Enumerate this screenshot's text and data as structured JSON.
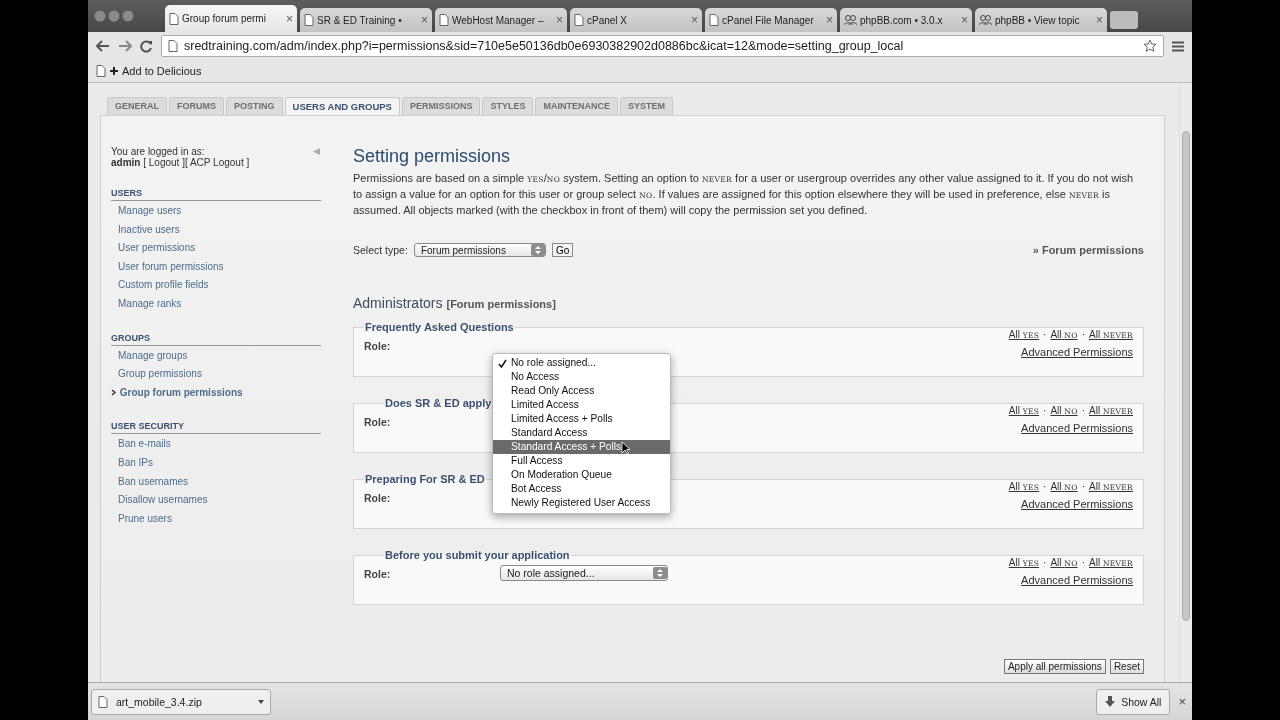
{
  "browser_tabs": [
    {
      "title": "Group forum permi",
      "kind": "page",
      "selected": true
    },
    {
      "title": "SR & ED Training •",
      "kind": "page",
      "selected": false
    },
    {
      "title": "WebHost Manager –",
      "kind": "page",
      "selected": false
    },
    {
      "title": "cPanel X",
      "kind": "page",
      "selected": false
    },
    {
      "title": "cPanel File Manager",
      "kind": "page",
      "selected": false
    },
    {
      "title": "phpBB.com • 3.0.x",
      "kind": "people",
      "selected": false
    },
    {
      "title": "phpBB • View topic",
      "kind": "people",
      "selected": false
    }
  ],
  "tab_close": "×",
  "address": "sredtraining.com/adm/index.php?i=permissions&sid=710e5e50136db0e6930382902d0886bc&icat=12&mode=setting_group_local",
  "bookmark": "Add to Delicious",
  "page_tabs": [
    {
      "label": "GENERAL",
      "selected": false
    },
    {
      "label": "FORUMS",
      "selected": false
    },
    {
      "label": "POSTING",
      "selected": false
    },
    {
      "label": "USERS AND GROUPS",
      "selected": true
    },
    {
      "label": "PERMISSIONS",
      "selected": false
    },
    {
      "label": "STYLES",
      "selected": false
    },
    {
      "label": "MAINTENANCE",
      "selected": false
    },
    {
      "label": "SYSTEM",
      "selected": false
    }
  ],
  "sidebar": {
    "logged_in_label": "You are logged in as:",
    "user": "admin",
    "user_links": [
      "[ Logout ]",
      "[ ACP Logout ]"
    ],
    "groups": [
      {
        "heading": "USERS",
        "items": [
          {
            "label": "Manage users",
            "selected": false
          },
          {
            "label": "Inactive users",
            "selected": false
          },
          {
            "label": "User permissions",
            "selected": false
          },
          {
            "label": "User forum permissions",
            "selected": false
          },
          {
            "label": "Custom profile fields",
            "selected": false
          },
          {
            "label": "Manage ranks",
            "selected": false
          }
        ]
      },
      {
        "heading": "GROUPS",
        "items": [
          {
            "label": "Manage groups",
            "selected": false
          },
          {
            "label": "Group permissions",
            "selected": false
          },
          {
            "label": "Group forum permissions",
            "selected": true
          }
        ]
      },
      {
        "heading": "USER SECURITY",
        "items": [
          {
            "label": "Ban e-mails",
            "selected": false
          },
          {
            "label": "Ban IPs",
            "selected": false
          },
          {
            "label": "Ban usernames",
            "selected": false
          },
          {
            "label": "Disallow usernames",
            "selected": false
          },
          {
            "label": "Prune users",
            "selected": false
          }
        ]
      }
    ]
  },
  "title": "Setting permissions",
  "description": [
    {
      "kind": "plain",
      "text": "Permissions are based on a simple "
    },
    {
      "kind": "code",
      "text": "YES"
    },
    {
      "kind": "plain",
      "text": "/"
    },
    {
      "kind": "code",
      "text": "NO"
    },
    {
      "kind": "plain",
      "text": " system. Setting an option to "
    },
    {
      "kind": "code",
      "text": "NEVER"
    },
    {
      "kind": "plain",
      "text": " for a user or usergroup overrides any other value assigned to it. If you do not wish to assign a value for an option for this user or group select "
    },
    {
      "kind": "code",
      "text": "NO"
    },
    {
      "kind": "plain",
      "text": ". If values are assigned for this option elsewhere they will be used in preference, else "
    },
    {
      "kind": "code",
      "text": "NEVER"
    },
    {
      "kind": "plain",
      "text": " is assumed. All objects marked (with the checkbox in front of them) will copy the permission set you defined."
    }
  ],
  "select_type": {
    "label": "Select type:",
    "value": "Forum permissions",
    "button": "Go"
  },
  "breadcrumb": "» Forum permissions",
  "group_name": "Administrators",
  "group_type": "[Forum permissions]",
  "sections": [
    {
      "legend": "Frequently Asked Questions",
      "indented": false,
      "role_label": "Role:",
      "quick_links": [
        {
          "text": "All",
          "tag": "YES"
        },
        {
          "text": "All",
          "tag": "NO"
        },
        {
          "text": "All",
          "tag": "NEVER"
        }
      ],
      "separators": [
        "·",
        "·"
      ],
      "advanced_link": "Advanced Permissions"
    },
    {
      "legend": "Does SR & ED apply",
      "indented": true,
      "role_label": "Role:",
      "quick_links": [
        {
          "text": "All",
          "tag": "YES"
        },
        {
          "text": "All",
          "tag": "NO"
        },
        {
          "text": "All",
          "tag": "NEVER"
        }
      ],
      "separators": [
        "·",
        "·"
      ],
      "advanced_link": "Advanced Permissions"
    },
    {
      "legend": "Preparing For SR & ED",
      "indented": false,
      "role_label": "Role:",
      "quick_links": [
        {
          "text": "All",
          "tag": "YES"
        },
        {
          "text": "All",
          "tag": "NO"
        },
        {
          "text": "All",
          "tag": "NEVER"
        }
      ],
      "separators": [
        "·",
        "·"
      ],
      "advanced_link": "Advanced Permissions"
    },
    {
      "legend": "Before you submit your application",
      "indented": true,
      "role_value": "No role assigned...",
      "role_label": "Role:",
      "quick_links": [
        {
          "text": "All",
          "tag": "YES"
        },
        {
          "text": "All",
          "tag": "NO"
        },
        {
          "text": "All",
          "tag": "NEVER"
        }
      ],
      "separators": [
        "·",
        "·"
      ],
      "advanced_link": "Advanced Permissions"
    }
  ],
  "role_menu": [
    {
      "label": "No role assigned...",
      "selected": true,
      "highlighted": false
    },
    {
      "label": "No Access",
      "selected": false,
      "highlighted": false
    },
    {
      "label": "Read Only Access",
      "selected": false,
      "highlighted": false
    },
    {
      "label": "Limited Access",
      "selected": false,
      "highlighted": false
    },
    {
      "label": "Limited Access + Polls",
      "selected": false,
      "highlighted": false
    },
    {
      "label": "Standard Access",
      "selected": false,
      "highlighted": false
    },
    {
      "label": "Standard Access + Polls",
      "selected": false,
      "highlighted": true
    },
    {
      "label": "Full Access",
      "selected": false,
      "highlighted": false
    },
    {
      "label": "On Moderation Queue",
      "selected": false,
      "highlighted": false
    },
    {
      "label": "Bot Access",
      "selected": false,
      "highlighted": false
    },
    {
      "label": "Newly Registered User Access",
      "selected": false,
      "highlighted": false
    }
  ],
  "buttons": [
    "Apply all permissions",
    "Reset"
  ],
  "download": {
    "file": "art_mobile_3.4.zip",
    "show_all": "Show All",
    "close": "×"
  }
}
